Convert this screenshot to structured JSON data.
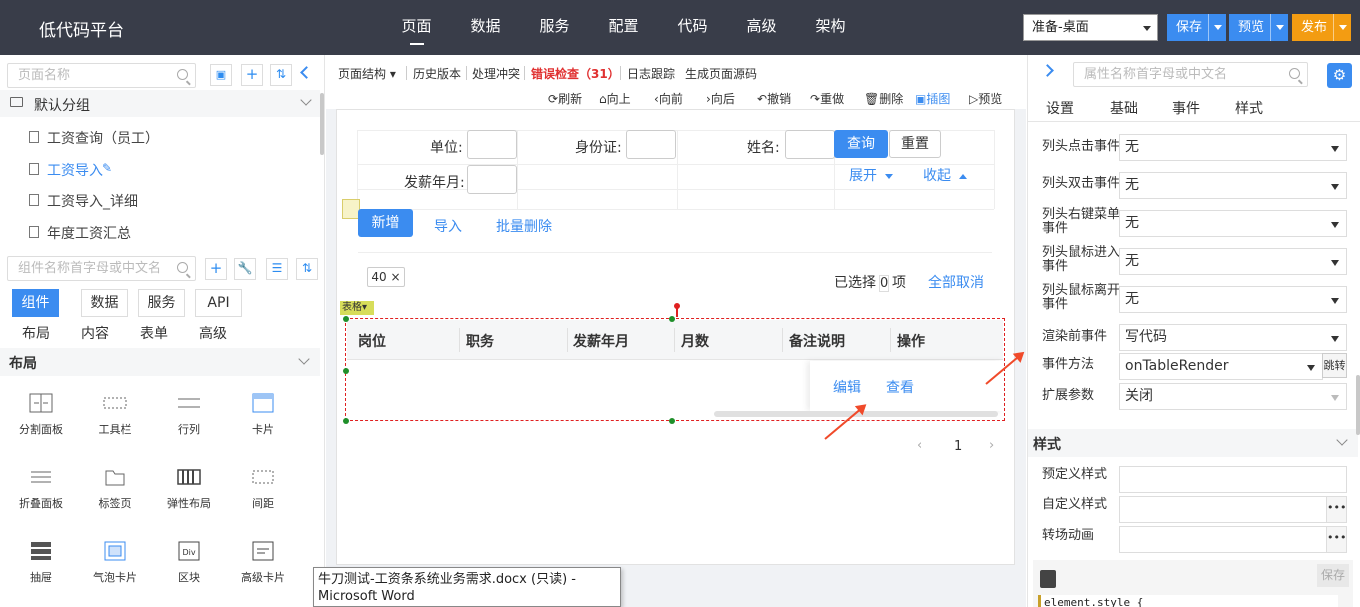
{
  "app": {
    "brand": "低代码平台",
    "nav": [
      "页面",
      "数据",
      "服务",
      "配置",
      "代码",
      "高级",
      "架构"
    ],
    "env": "准备-桌面",
    "buttons": {
      "save": "保存",
      "preview": "预览",
      "publish": "发布"
    },
    "colors": {
      "topbar": "#393d49",
      "accent": "#3b8cf0",
      "publish": "#f39c12",
      "error": "#e03030"
    }
  },
  "left": {
    "page_search_placeholder": "页面名称",
    "group": "默认分组",
    "pages": [
      "工资查询（员工）",
      "工资导入",
      "工资导入_详细",
      "年度工资汇总"
    ],
    "active_page": 1,
    "component_search_placeholder": "组件名称首字母或中文名",
    "tabs": [
      "组件",
      "数据",
      "服务",
      "API"
    ],
    "subtabs": [
      "布局",
      "内容",
      "表单",
      "高级"
    ],
    "section": "布局",
    "components": [
      "分割面板",
      "工具栏",
      "行列",
      "卡片",
      "折叠面板",
      "标签页",
      "弹性布局",
      "间距",
      "抽屉",
      "气泡卡片",
      "区块",
      "高级卡片"
    ]
  },
  "toolbar": {
    "items": [
      "页面结构",
      "历史版本",
      "处理冲突",
      "错误检查",
      "日志跟踪",
      "生成页面源码"
    ],
    "error_count": "（31）",
    "actions": [
      "刷新",
      "向上",
      "向前",
      "向后",
      "撤销",
      "重做",
      "删除",
      "插图",
      "预览"
    ]
  },
  "form": {
    "labels": [
      "单位:",
      "身份证:",
      "姓名:",
      "发薪年月:"
    ],
    "query": "查询",
    "reset": "重置",
    "expand": "展开",
    "collapse": "收起",
    "new": "新增",
    "import": "导入",
    "batch_delete": "批量删除",
    "page_size": "40",
    "selected_prefix": "已选择",
    "selected_count": "0",
    "selected_suffix": "项",
    "deselect_all": "全部取消",
    "table_tag": "表格"
  },
  "table": {
    "columns": [
      "岗位",
      "职务",
      "发薪年月",
      "月数",
      "备注说明",
      "操作"
    ],
    "row_actions": [
      "编辑",
      "查看"
    ],
    "page": "1"
  },
  "tooltip": "牛刀测试-工资条系统业务需求.docx (只读) - Microsoft Word",
  "right": {
    "search_placeholder": "属性名称首字母或中文名",
    "tabs": [
      "设置",
      "基础",
      "事件",
      "样式"
    ],
    "events": [
      {
        "label": "列头点击事件",
        "value": "无"
      },
      {
        "label": "列头双击事件",
        "value": "无"
      },
      {
        "label": "列头右键菜单事件",
        "value": "无"
      },
      {
        "label": "列头鼠标进入事件",
        "value": "无"
      },
      {
        "label": "列头鼠标离开事件",
        "value": "无"
      },
      {
        "label": "渲染前事件",
        "value": "写代码"
      }
    ],
    "event_method_label": "事件方法",
    "event_method": "onTableRender",
    "jump": "跳转",
    "ext_label": "扩展参数",
    "ext_value": "关闭",
    "style_section": "样式",
    "predefined_style": "预定义样式",
    "custom_style": "自定义样式",
    "transition": "转场动画",
    "code_save": "保存",
    "code_line": "element.style {"
  }
}
